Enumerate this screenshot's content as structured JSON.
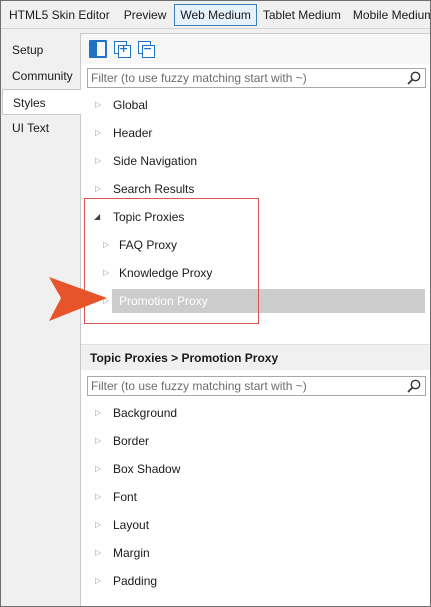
{
  "toolbar": {
    "items": [
      {
        "label": "HTML5 Skin Editor",
        "active": false
      },
      {
        "label": "Preview",
        "active": false
      },
      {
        "label": "Web Medium",
        "active": true
      },
      {
        "label": "Tablet Medium",
        "active": false
      },
      {
        "label": "Mobile Medium",
        "active": false
      }
    ]
  },
  "left_tabs": [
    {
      "label": "Setup"
    },
    {
      "label": "Community"
    },
    {
      "label": "Styles",
      "selected": true
    },
    {
      "label": "UI Text"
    }
  ],
  "icons": {
    "panel": "panel-toggle-icon",
    "expand_all": "expand-all-icon",
    "collapse_all": "collapse-all-icon",
    "search": "search-icon"
  },
  "filter_top": {
    "placeholder": "Filter (to use fuzzy matching start with ~)",
    "value": ""
  },
  "style_tree": [
    {
      "label": "Global",
      "expanded": false,
      "level": 0
    },
    {
      "label": "Header",
      "expanded": false,
      "level": 0
    },
    {
      "label": "Side Navigation",
      "expanded": false,
      "level": 0
    },
    {
      "label": "Search Results",
      "expanded": false,
      "level": 0
    },
    {
      "label": "Topic Proxies",
      "expanded": true,
      "level": 0
    },
    {
      "label": "FAQ Proxy",
      "expanded": false,
      "level": 1
    },
    {
      "label": "Knowledge Proxy",
      "expanded": false,
      "level": 1
    },
    {
      "label": "Promotion Proxy",
      "expanded": false,
      "level": 1,
      "selected": true
    }
  ],
  "properties_header": "Topic Proxies > Promotion Proxy",
  "filter_bottom": {
    "placeholder": "Filter (to use fuzzy matching start with ~)",
    "value": ""
  },
  "property_groups": [
    {
      "label": "Background"
    },
    {
      "label": "Border"
    },
    {
      "label": "Box Shadow"
    },
    {
      "label": "Font"
    },
    {
      "label": "Layout"
    },
    {
      "label": "Margin"
    },
    {
      "label": "Padding"
    }
  ],
  "colors": {
    "accent": "#1f72c6",
    "selection": "#cccccc",
    "callout": "#d9534f",
    "arrow": "#e8542a"
  }
}
